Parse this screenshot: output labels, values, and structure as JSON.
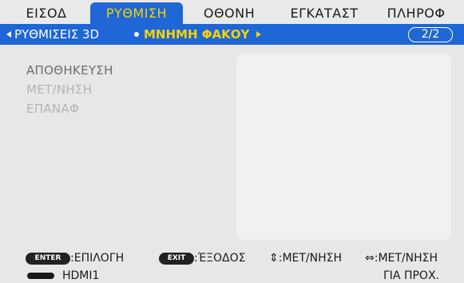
{
  "tabs": [
    {
      "label": "ΕΙΣΟΔ",
      "active": false
    },
    {
      "label": "ΡΥΘΜΙΣΗ",
      "active": true
    },
    {
      "label": "ΟΘΟΝΗ",
      "active": false
    },
    {
      "label": "ΕΓΚΑΤΑΣΤ",
      "active": false
    },
    {
      "label": "ΠΛΗΡΟΦ",
      "active": false
    }
  ],
  "breadcrumb": {
    "parent": "ΡΥΘΜΙΣΕΙΣ 3D",
    "current": "ΜΝΗΜΗ ΦΑΚΟΥ",
    "page": "2/2"
  },
  "menu": {
    "items": [
      {
        "label": "ΑΠΟΘΗΚΕΥΣΗ",
        "enabled": true
      },
      {
        "label": "ΜΕΤ/ΝΗΣΗ",
        "enabled": false
      },
      {
        "label": "ΕΠΑΝΑΦ",
        "enabled": false
      }
    ]
  },
  "hints": {
    "enter_key": "ENTER",
    "enter_label": ":ΕΠΙΛΟΓΗ",
    "exit_key": "EXIT",
    "exit_label": ":ΈΞΟΔΟΣ",
    "updown_label": "⇕:ΜΕΤ/ΝΗΣΗ",
    "leftright_label": "⇔:ΜΕΤ/ΝΗΣΗ"
  },
  "status": {
    "source_icon": "hdmi-connector-icon",
    "source": "HDMI1",
    "mode": "ΓΙΑ ΠΡΟΧ."
  },
  "colors": {
    "accent_blue": "#1f66d6",
    "highlight_yellow": "#f5d400",
    "background": "#e7e7e7"
  }
}
